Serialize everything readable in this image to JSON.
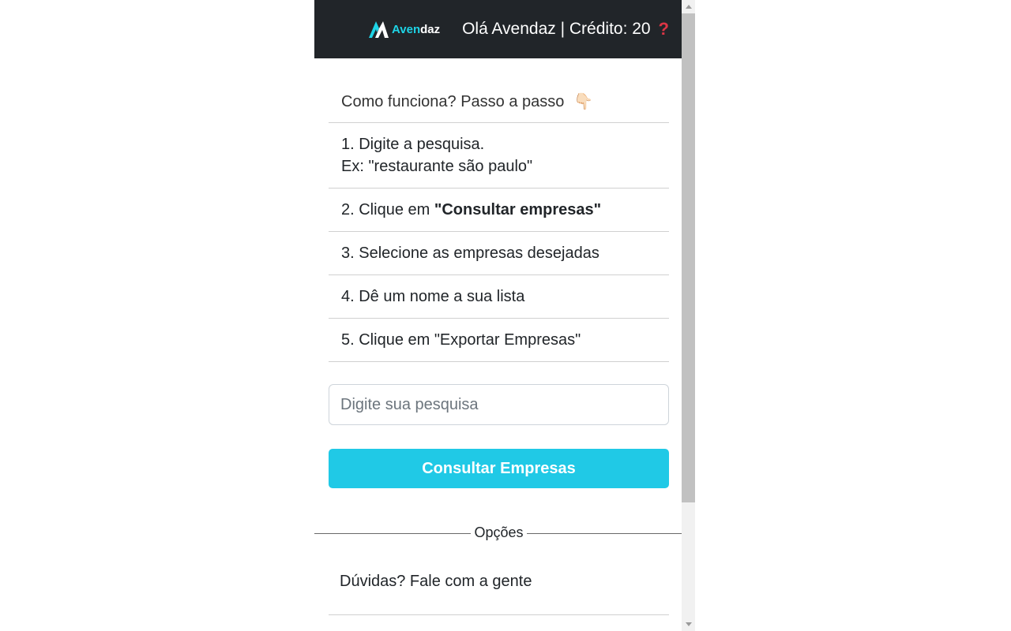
{
  "header": {
    "logo_brand_a": "Aven",
    "logo_brand_b": "daz",
    "greeting": "Olá Avendaz | Crédito: 20",
    "help_symbol": "?"
  },
  "howto": {
    "title": "Como funciona? Passo a passo",
    "pointer_emoji": "👇🏻",
    "step1_line1": "1. Digite a pesquisa.",
    "step1_line2": "Ex: \"restaurante são paulo\"",
    "step2_prefix": "2. Clique em ",
    "step2_bold": "\"Consultar empresas\"",
    "step3": "3. Selecione as empresas desejadas",
    "step4": "4. Dê um nome a sua lista",
    "step5": "5. Clique em \"Exportar Empresas\""
  },
  "search": {
    "placeholder": "Digite sua pesquisa",
    "button": "Consultar Empresas"
  },
  "options_label": "Opções",
  "faq": "Dúvidas? Fale com a gente",
  "colors": {
    "header_bg": "#212529",
    "accent": "#20c9e6",
    "help": "#dc3545",
    "logo_cyan": "#1ed4e6"
  }
}
